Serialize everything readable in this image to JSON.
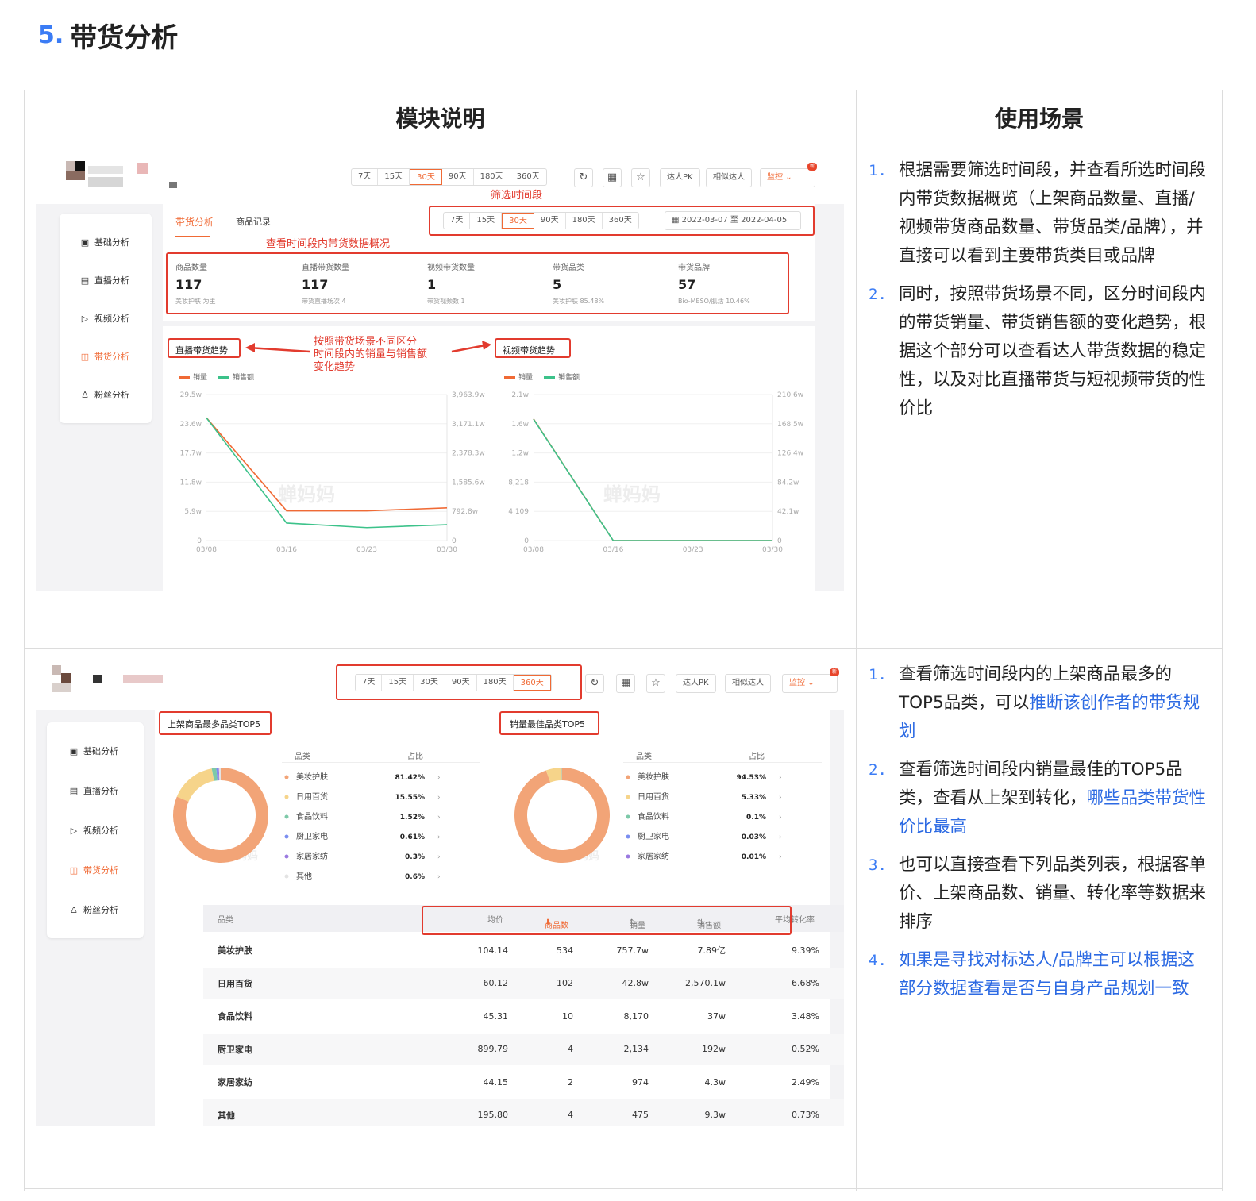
{
  "heading": {
    "number": "5.",
    "title": "带货分析"
  },
  "table_headers": {
    "module": "模块说明",
    "usage": "使用场景"
  },
  "sc1": {
    "tabs": [
      "7天",
      "15天",
      "30天",
      "90天",
      "180天",
      "360天"
    ],
    "tabs2": [
      "7天",
      "15天",
      "30天",
      "90天",
      "180天",
      "360天"
    ],
    "pk": "达人PK",
    "similar": "相似达人",
    "monitor": "监控",
    "new_badge": "新",
    "ann_filter": "筛选时间段",
    "ann_overview": "查看时间段内带货数据概况",
    "ann_trend": [
      "按照带货场景不同区分",
      "时间段内的销量与销售额",
      "变化趋势"
    ],
    "subtab_active": "带货分析",
    "subtab_other": "商品记录",
    "date_range": "2022-03-07 至 2022-04-05",
    "sidebar": [
      "基础分析",
      "直播分析",
      "视频分析",
      "带货分析",
      "粉丝分析"
    ],
    "stats": [
      {
        "label": "商品数量",
        "value": "117",
        "sub": "美妆护肤 为主"
      },
      {
        "label": "直播带货数量",
        "value": "117",
        "sub": "带货直播场次 4"
      },
      {
        "label": "视频带货数量",
        "value": "1",
        "sub": "带货视频数 1"
      },
      {
        "label": "带货品类",
        "value": "5",
        "sub": "美妆护肤 85.48%"
      },
      {
        "label": "带货品牌",
        "value": "57",
        "sub": "Bio-MESO/肌活 10.46%"
      }
    ],
    "live_title": "直播带货趋势",
    "video_title": "视频带货趋势",
    "legend_sales": "销量",
    "legend_amount": "销售额",
    "watermark": "蝉妈妈"
  },
  "chart_data": [
    {
      "type": "line",
      "title": "直播带货趋势",
      "x": [
        "03/08",
        "03/16",
        "03/23",
        "03/30"
      ],
      "y_left_ticks": [
        "29.5w",
        "23.6w",
        "17.7w",
        "11.8w",
        "5.9w",
        "0"
      ],
      "y_right_ticks": [
        "3,963.9w",
        "3,171.1w",
        "2,378.3w",
        "1,585.6w",
        "792.8w",
        "0"
      ],
      "series": [
        {
          "name": "销量",
          "color": "#f06a35",
          "values": [
            24.8,
            6.0,
            6.0,
            6.6
          ]
        },
        {
          "name": "销售额",
          "color": "#3cc28a",
          "values": [
            3330,
            475,
            350,
            430
          ]
        }
      ]
    },
    {
      "type": "line",
      "title": "视频带货趋势",
      "x": [
        "03/08",
        "03/16",
        "03/23",
        "03/30"
      ],
      "y_left_ticks": [
        "2.1w",
        "1.6w",
        "1.2w",
        "8,218",
        "4,109",
        "0"
      ],
      "y_right_ticks": [
        "210.6w",
        "168.5w",
        "126.4w",
        "84.2w",
        "42.1w",
        "0"
      ],
      "series": [
        {
          "name": "销量",
          "color": "#f06a35",
          "values": [
            1.75,
            0,
            0,
            0
          ]
        },
        {
          "name": "销售额",
          "color": "#3cc28a",
          "values": [
            175,
            0,
            0,
            0
          ]
        }
      ]
    },
    {
      "type": "pie",
      "title": "上架商品最多品类TOP5",
      "categories": [
        "美妆护肤",
        "日用百货",
        "食品饮料",
        "厨卫家电",
        "家居家纺",
        "其他"
      ],
      "values": [
        81.42,
        15.55,
        1.52,
        0.61,
        0.3,
        0.6
      ],
      "labels": [
        "81.42%",
        "15.55%",
        "1.52%",
        "0.61%",
        "0.3%",
        "0.6%"
      ],
      "colors": [
        "#f2a477",
        "#f6d48a",
        "#7dc9a8",
        "#7b8ef0",
        "#9a7ae0",
        "#e3e3e3"
      ]
    },
    {
      "type": "pie",
      "title": "销量最佳品类TOP5",
      "categories": [
        "美妆护肤",
        "日用百货",
        "食品饮料",
        "厨卫家电",
        "家居家纺"
      ],
      "values": [
        94.53,
        5.33,
        0.1,
        0.03,
        0.01
      ],
      "labels": [
        "94.53%",
        "5.33%",
        "0.1%",
        "0.03%",
        "0.01%"
      ],
      "colors": [
        "#f2a477",
        "#f6d48a",
        "#7dc9a8",
        "#7b8ef0",
        "#9a7ae0"
      ]
    }
  ],
  "sc2": {
    "tabs": [
      "7天",
      "15天",
      "30天",
      "90天",
      "180天",
      "360天"
    ],
    "pk": "达人PK",
    "similar": "相似达人",
    "monitor": "监控",
    "new_badge": "新",
    "sidebar": [
      "基础分析",
      "直播分析",
      "视频分析",
      "带货分析",
      "粉丝分析"
    ],
    "pie1_title": "上架商品最多品类TOP5",
    "pie2_title": "销量最佳品类TOP5",
    "col_cat": "品类",
    "col_pct": "占比",
    "watermark": "蝉妈妈",
    "table_headers": [
      "品类",
      "均价",
      "商品数",
      "销量",
      "销售额",
      "平均转化率"
    ],
    "rows": [
      [
        "美妆护肤",
        "104.14",
        "534",
        "757.7w",
        "7.89亿",
        "9.39%"
      ],
      [
        "日用百货",
        "60.12",
        "102",
        "42.8w",
        "2,570.1w",
        "6.68%"
      ],
      [
        "食品饮料",
        "45.31",
        "10",
        "8,170",
        "37w",
        "3.48%"
      ],
      [
        "厨卫家电",
        "899.79",
        "4",
        "2,134",
        "192w",
        "0.52%"
      ],
      [
        "家居家纺",
        "44.15",
        "2",
        "974",
        "4.3w",
        "2.49%"
      ],
      [
        "其他",
        "195.80",
        "4",
        "475",
        "9.3w",
        "0.73%"
      ]
    ]
  },
  "usage1": [
    {
      "n": "1.",
      "text": "根据需要筛选时间段，并查看所选时间段内带货数据概览（上架商品数量、直播/视频带货商品数量、带货品类/品牌），并直接可以看到主要带货类目或品牌"
    },
    {
      "n": "2.",
      "text": "同时，按照带货场景不同，区分时间段内的带货销量、带货销售额的变化趋势，根据这个部分可以查看达人带货数据的稳定性，以及对比直播带货与短视频带货的性价比"
    }
  ],
  "usage2": [
    {
      "n": "1.",
      "text": "查看筛选时间段内的上架商品最多的TOP5品类，可以",
      "link": "推断该创作者的带货规划",
      "tail": ""
    },
    {
      "n": "2.",
      "text": "查看筛选时间段内销量最佳的TOP5品类，查看从上架到转化，",
      "link": "哪些品类带货性价比最高",
      "tail": ""
    },
    {
      "n": "3.",
      "text": "也可以直接查看下列品类列表，根据客单价、上架商品数、销量、转化率等数据来排序",
      "link": "",
      "tail": ""
    },
    {
      "n": "4.",
      "text": "",
      "link": "如果是寻找对标达人/品牌主可以根据这部分数据查看是否与自身产品规划一致",
      "tail": ""
    }
  ]
}
